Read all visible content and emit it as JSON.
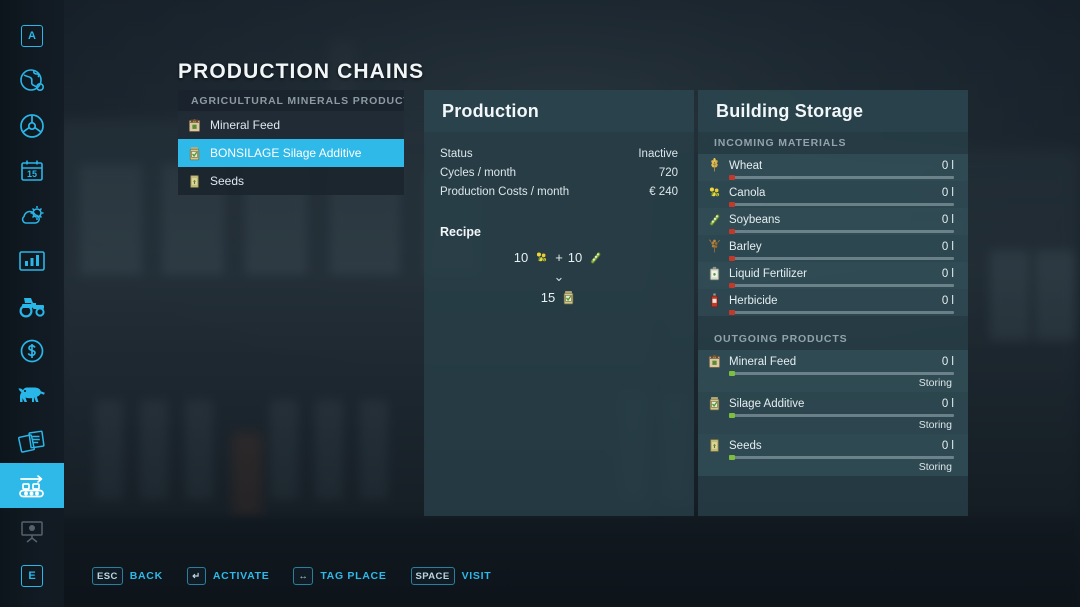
{
  "app": {
    "page_title": "PRODUCTION CHAINS"
  },
  "sidebar": {
    "items": [
      {
        "name": "map-key-a",
        "icon": "key-a-icon",
        "key_label": "A",
        "state": "normal"
      },
      {
        "name": "globe",
        "icon": "globe-icon",
        "state": "normal"
      },
      {
        "name": "vehicles-steering",
        "icon": "steering-wheel-icon",
        "state": "normal"
      },
      {
        "name": "calendar",
        "icon": "calendar-icon",
        "key_label": "15",
        "state": "normal"
      },
      {
        "name": "weather",
        "icon": "weather-sun-cloud-icon",
        "state": "normal"
      },
      {
        "name": "statistics",
        "icon": "bar-chart-icon",
        "state": "normal"
      },
      {
        "name": "vehicles",
        "icon": "tractor-icon",
        "state": "normal"
      },
      {
        "name": "finances",
        "icon": "dollar-coin-icon",
        "state": "normal"
      },
      {
        "name": "animals",
        "icon": "cow-icon",
        "state": "normal"
      },
      {
        "name": "contracts",
        "icon": "documents-icon",
        "state": "normal"
      },
      {
        "name": "production-chains",
        "icon": "conveyor-belt-icon",
        "state": "selected"
      },
      {
        "name": "construction",
        "icon": "easel-icon",
        "state": "dimmed"
      },
      {
        "name": "key-e",
        "icon": "key-e-icon",
        "key_label": "E",
        "state": "normal"
      }
    ]
  },
  "chain_list": {
    "header": "AGRICULTURAL MINERALS PRODUCTION",
    "items": [
      {
        "label": "Mineral Feed",
        "icon": "mineral-feed-icon",
        "selected": false
      },
      {
        "label": "BONSILAGE Silage Additive",
        "icon": "silage-additive-icon",
        "selected": true
      },
      {
        "label": "Seeds",
        "icon": "seeds-icon",
        "selected": false
      }
    ]
  },
  "production": {
    "title": "Production",
    "stats": [
      {
        "label": "Status",
        "value": "Inactive"
      },
      {
        "label": "Cycles / month",
        "value": "720"
      },
      {
        "label": "Production Costs / month",
        "value": "€ 240"
      }
    ],
    "recipe_title": "Recipe",
    "recipe": {
      "inputs": [
        {
          "amount": "10",
          "icon": "canola-icon"
        },
        {
          "plus": "+",
          "amount": "10",
          "icon": "soybeans-icon"
        }
      ],
      "plus_sign": "+",
      "arrow": "⌄",
      "outputs": [
        {
          "amount": "15",
          "icon": "silage-additive-icon"
        }
      ]
    }
  },
  "building_storage": {
    "title": "Building Storage",
    "incoming_header": "INCOMING MATERIALS",
    "incoming": [
      {
        "name": "Wheat",
        "amount": "0 l",
        "icon": "wheat-icon",
        "fill": 0,
        "dot": "#c0392b"
      },
      {
        "name": "Canola",
        "amount": "0 l",
        "icon": "canola-icon",
        "fill": 0,
        "dot": "#c0392b"
      },
      {
        "name": "Soybeans",
        "amount": "0 l",
        "icon": "soybeans-icon",
        "fill": 0,
        "dot": "#c0392b"
      },
      {
        "name": "Barley",
        "amount": "0 l",
        "icon": "barley-icon",
        "fill": 0,
        "dot": "#c0392b"
      },
      {
        "name": "Liquid Fertilizer",
        "amount": "0 l",
        "icon": "liquid-fertilizer-icon",
        "fill": 0,
        "dot": "#c0392b"
      },
      {
        "name": "Herbicide",
        "amount": "0 l",
        "icon": "herbicide-icon",
        "fill": 0,
        "dot": "#c0392b"
      }
    ],
    "outgoing_header": "OUTGOING PRODUCTS",
    "outgoing": [
      {
        "name": "Mineral Feed",
        "amount": "0 l",
        "icon": "mineral-feed-icon",
        "fill": 0,
        "dot": "#7cbf3f",
        "status": "Storing"
      },
      {
        "name": "Silage Additive",
        "amount": "0 l",
        "icon": "silage-additive-icon",
        "fill": 0,
        "dot": "#7cbf3f",
        "status": "Storing"
      },
      {
        "name": "Seeds",
        "amount": "0 l",
        "icon": "seeds-icon",
        "fill": 0,
        "dot": "#7cbf3f",
        "status": "Storing"
      }
    ]
  },
  "help_bar": [
    {
      "key": "ESC",
      "label": "BACK"
    },
    {
      "key": "↵",
      "label": "ACTIVATE"
    },
    {
      "key": "↔",
      "label": "TAG PLACE"
    },
    {
      "key": "SPACE",
      "label": "VISIT"
    }
  ],
  "colors": {
    "accent_cyan": "#2fb9e8",
    "panel_bg": "#284049",
    "status_red": "#c0392b",
    "status_green": "#7cbf3f"
  }
}
